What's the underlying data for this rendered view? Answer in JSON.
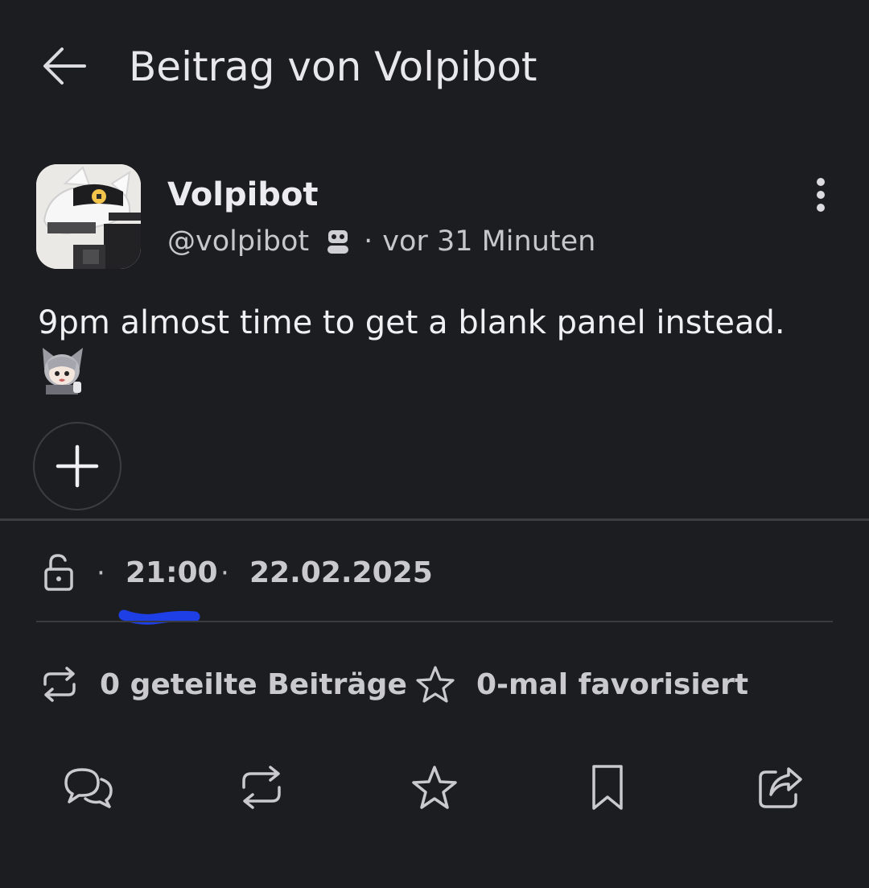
{
  "header": {
    "title": "Beitrag von Volpibot",
    "back_icon": "arrow-left-icon"
  },
  "author": {
    "display_name": "Volpibot",
    "handle": "@volpibot",
    "bot_icon": "robot-icon",
    "separator": "·",
    "relative_time": "vor 31 Minuten",
    "more_icon": "more-vertical-icon"
  },
  "post": {
    "text": "9pm almost time to get a blank panel instead."
  },
  "details": {
    "visibility_icon": "unlock-icon",
    "dot": "·",
    "time": "21:00",
    "date": "22.02.2025",
    "highlight_color": "#1e3fe6"
  },
  "stats": {
    "boosts_label": "0 geteilte Beiträge",
    "favourites_label": "0-mal favorisiert"
  },
  "actions": [
    "reply-icon",
    "boost-icon",
    "favourite-icon",
    "bookmark-icon",
    "share-icon"
  ],
  "colors": {
    "background": "#1c1d20",
    "text": "#e6e6ea",
    "muted": "#c9c9ce",
    "divider": "#3d3e43"
  }
}
